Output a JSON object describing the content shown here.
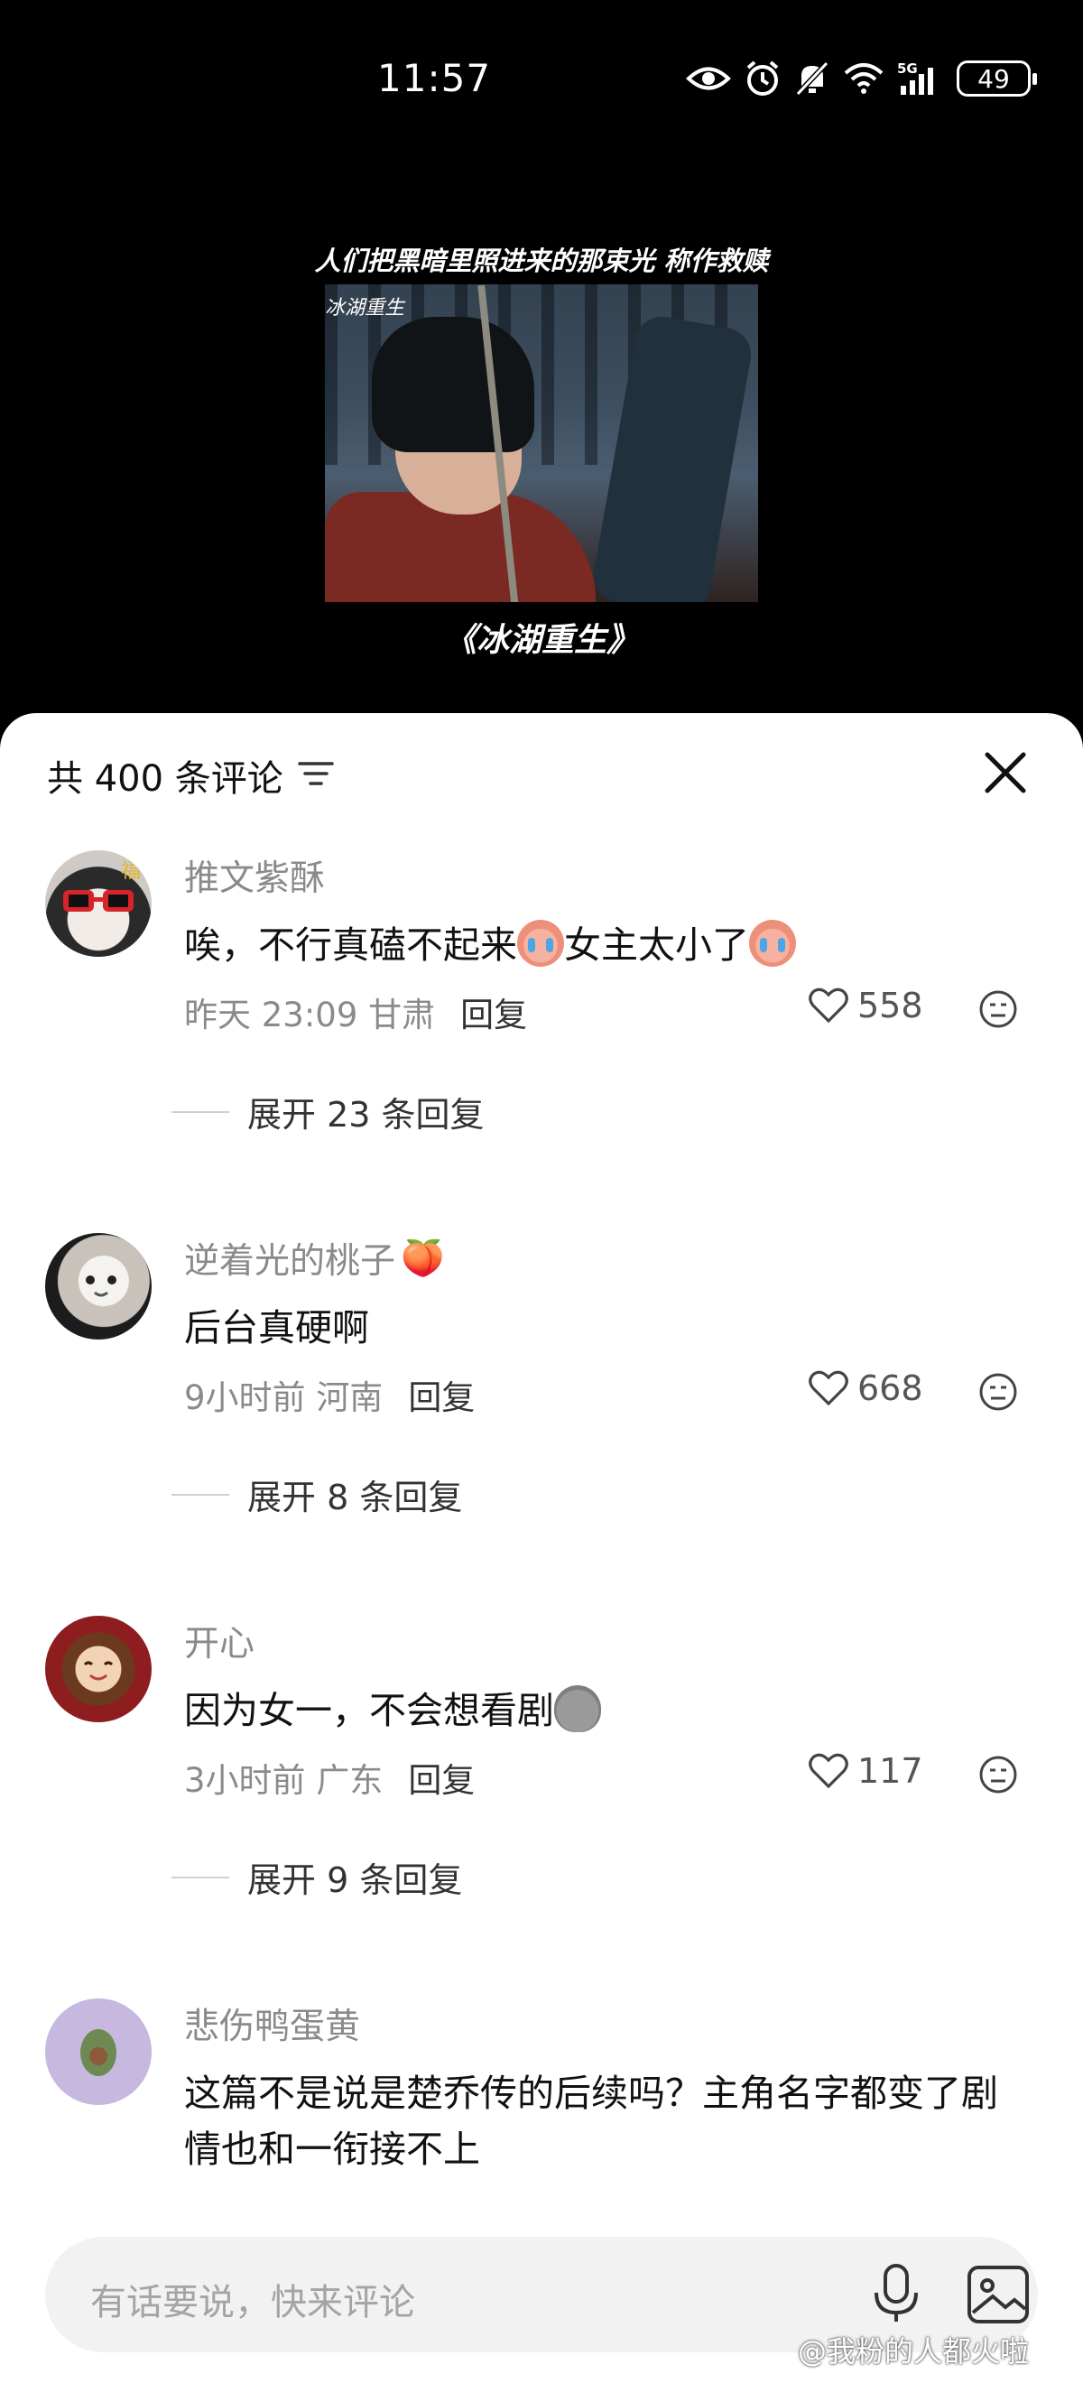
{
  "status_bar": {
    "time": "11:57",
    "network": "5G",
    "battery": "49",
    "icons": [
      "eye-icon",
      "alarm-icon",
      "mute-icon",
      "wifi-icon",
      "signal-icon",
      "battery-icon"
    ]
  },
  "video": {
    "caption": "人们把黑暗里照进来的那束光 称作救赎",
    "logo_text": "冰湖重生",
    "title": "《冰湖重生》"
  },
  "comments_header": {
    "count_label": "共 400 条评论"
  },
  "comments": [
    {
      "user": "推文紫酥",
      "user_badge": "",
      "text_parts": [
        "唉，不行真磕不起来",
        "女主太小了"
      ],
      "time": "昨天 23:09",
      "location": "甘肃",
      "reply_label": "回复",
      "likes": "558",
      "expand_label": "展开 23 条回复"
    },
    {
      "user": "逆着光的桃子",
      "user_badge": "🍑",
      "text": "后台真硬啊",
      "time": "9小时前",
      "location": "河南",
      "reply_label": "回复",
      "likes": "668",
      "expand_label": "展开 8 条回复"
    },
    {
      "user": "开心",
      "user_badge": "",
      "text": "因为女一，不会想看剧",
      "time": "3小时前",
      "location": "广东",
      "reply_label": "回复",
      "likes": "117",
      "expand_label": "展开 9 条回复"
    },
    {
      "user": "悲伤鸭蛋黄",
      "user_badge": "",
      "text": "这篇不是说是楚乔传的后续吗？主角名字都变了剧情也和一衔接不上"
    }
  ],
  "input": {
    "placeholder": "有话要说，快来评论"
  },
  "watermark": "@我粉的人都火啦",
  "colors": {
    "accent_text": "#111111",
    "secondary_text": "#8a8a8a",
    "background": "#ffffff",
    "video_bg": "#000000"
  }
}
